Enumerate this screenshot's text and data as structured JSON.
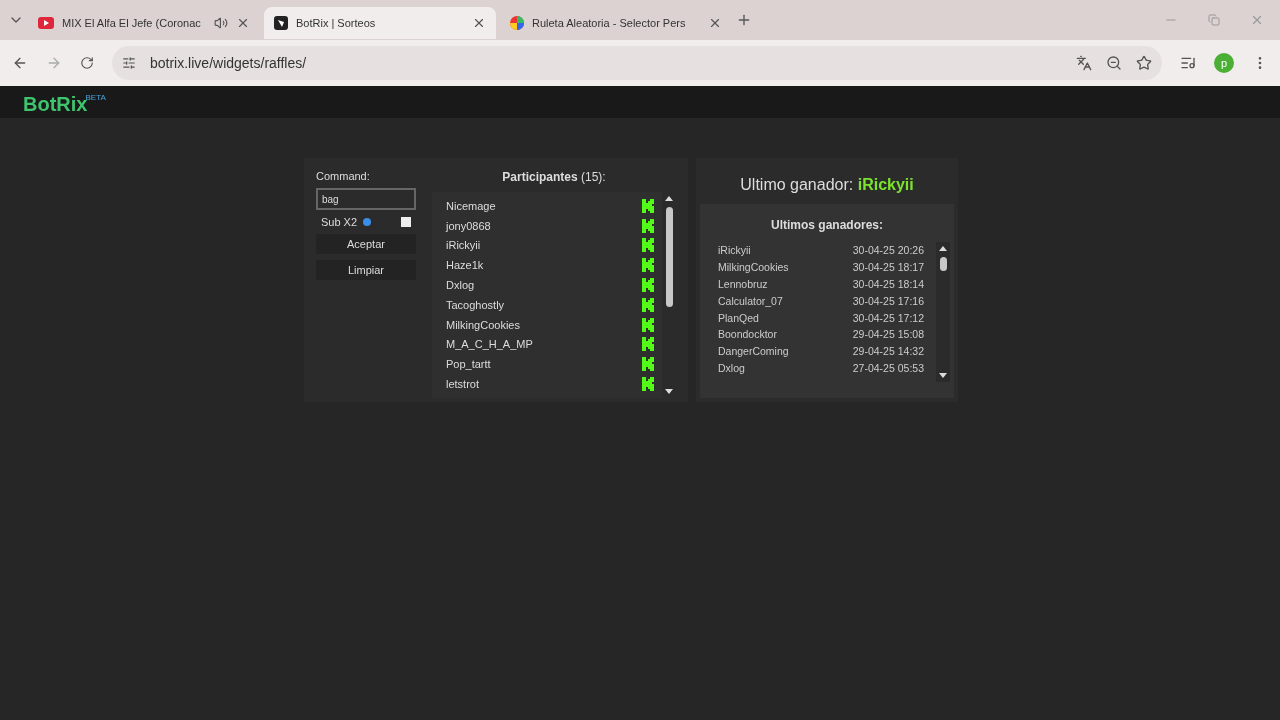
{
  "browser": {
    "tabs": [
      {
        "title": "MIX El Alfa El Jefe (Coronac",
        "kind": "video",
        "audio": true,
        "selected": false
      },
      {
        "title": "BotRix | Sorteos",
        "kind": "botrix",
        "audio": false,
        "selected": true
      },
      {
        "title": "Ruleta Aleatoria - Selector Pers",
        "kind": "wheel",
        "audio": false,
        "selected": false
      }
    ],
    "url": "botrix.live/widgets/raffles/",
    "profile_initial": "p"
  },
  "header": {
    "logo": "BotRix",
    "badge": "BETA"
  },
  "controls": {
    "command_label": "Command:",
    "command_value": "bag",
    "sub_label": "Sub X2",
    "sub_checked": false,
    "buttons": [
      "Aceptar",
      "Limpiar"
    ]
  },
  "participants": {
    "title": "Participantes",
    "count": "(15):",
    "items": [
      "Nicemage",
      "jony0868",
      "iRickyii",
      "Haze1k",
      "Dxlog",
      "Tacoghostly",
      "MilkingCookies",
      "M_A_C_H_A_MP",
      "Pop_tartt",
      "letstrot"
    ]
  },
  "winner": {
    "label": "Ultimo ganador:",
    "name": "iRickyii"
  },
  "winners": {
    "title": "Ultimos ganadores:",
    "rows": [
      {
        "name": "iRickyii",
        "date": "30-04-25 20:26"
      },
      {
        "name": "MilkingCookies",
        "date": "30-04-25 18:17"
      },
      {
        "name": "Lennobruz",
        "date": "30-04-25 18:14"
      },
      {
        "name": "Calculator_07",
        "date": "30-04-25 17:16"
      },
      {
        "name": "PlanQed",
        "date": "30-04-25 17:12"
      },
      {
        "name": "Boondocktor",
        "date": "29-04-25 15:08"
      },
      {
        "name": "DangerComing",
        "date": "29-04-25 14:32"
      },
      {
        "name": "Dxlog",
        "date": "27-04-25 05:53"
      }
    ]
  }
}
